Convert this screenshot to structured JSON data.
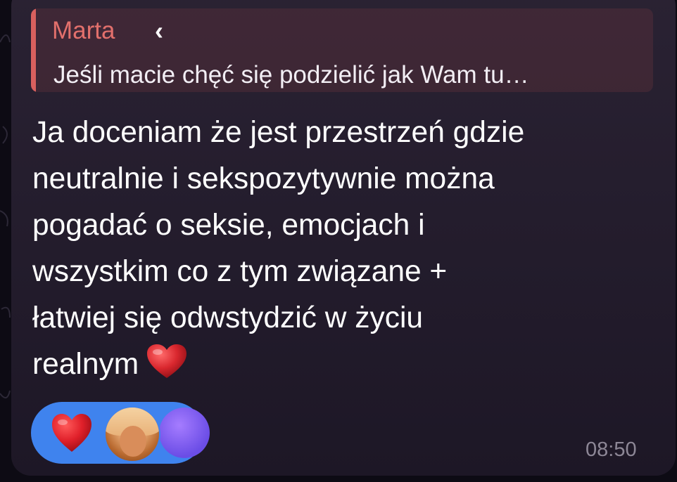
{
  "reply": {
    "author": "Marta",
    "preview": "Jeśli macie chęć się podzielić jak Wam tu…"
  },
  "message": {
    "lines": [
      "Ja doceniam że jest przestrzeń gdzie",
      "neutralnie i sekspozytywnie można",
      "pogadać o seksie, emocjach i",
      "wszystkim co z tym związane +",
      "łatwiej się odwstydzić w życiu",
      "realnym"
    ],
    "trailing_emoji": "heart-emoji"
  },
  "reaction": {
    "emoji": "heart-emoji",
    "avatars": [
      "user-avatar-photo",
      "user-avatar-initial"
    ],
    "avatar_initial": "‹"
  },
  "timestamp": "08:50",
  "colors": {
    "bubble": "#2a2233",
    "reply_accent": "#d8605e",
    "reply_author": "#e2706c",
    "reaction_pill": "#3f83ee",
    "timestamp": "#8d8796",
    "heart": "#d9272e"
  }
}
